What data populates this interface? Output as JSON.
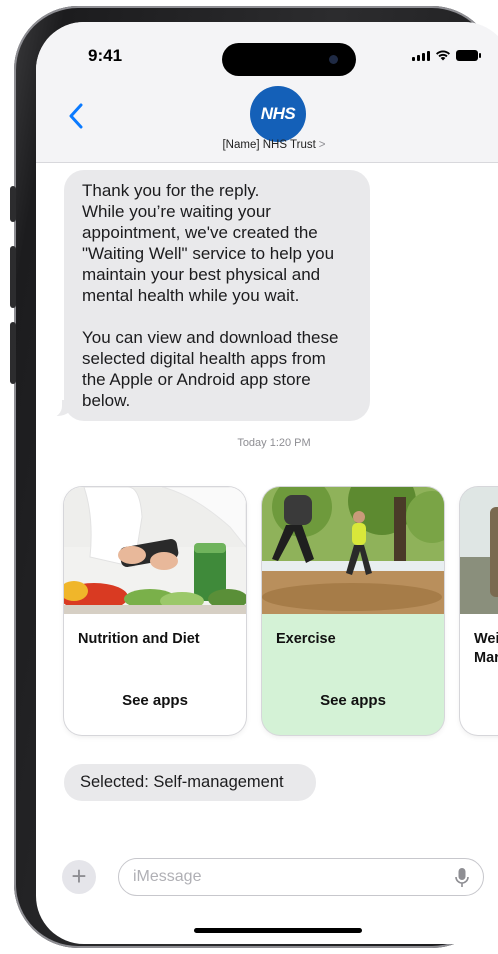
{
  "status_bar": {
    "time": "9:41"
  },
  "header": {
    "avatar_text": "NHS",
    "contact_name": "[Name] NHS Trust",
    "contact_chevron": ">",
    "back_icon": "chevron-left-icon"
  },
  "message": {
    "paragraph1": "Thank you for the reply.\nWhile you’re waiting your\nappointment, we've created the\n\"Waiting Well\" service to help you\nmaintain your best physical and\nmental health while you wait.",
    "paragraph2": "You can view and download these\nselected digital health apps from\nthe Apple or Android app store\nbelow."
  },
  "timestamp": "Today 1:20 PM",
  "cards": [
    {
      "title": "Nutrition and Diet",
      "action": "See apps",
      "background": "#ffffff"
    },
    {
      "title": "Exercise",
      "action": "See apps",
      "background": "#d4f2d6"
    },
    {
      "title": "Wei\nMar",
      "action": "",
      "background": "#ffffff"
    }
  ],
  "selected_reply": "Selected: Self-management",
  "composer": {
    "placeholder": "iMessage",
    "plus_label": "+"
  },
  "colors": {
    "accent": "#0a7aff",
    "nhs_blue": "#1460b8",
    "bubble": "#e9e9eb",
    "exercise_card": "#d4f2d6"
  }
}
